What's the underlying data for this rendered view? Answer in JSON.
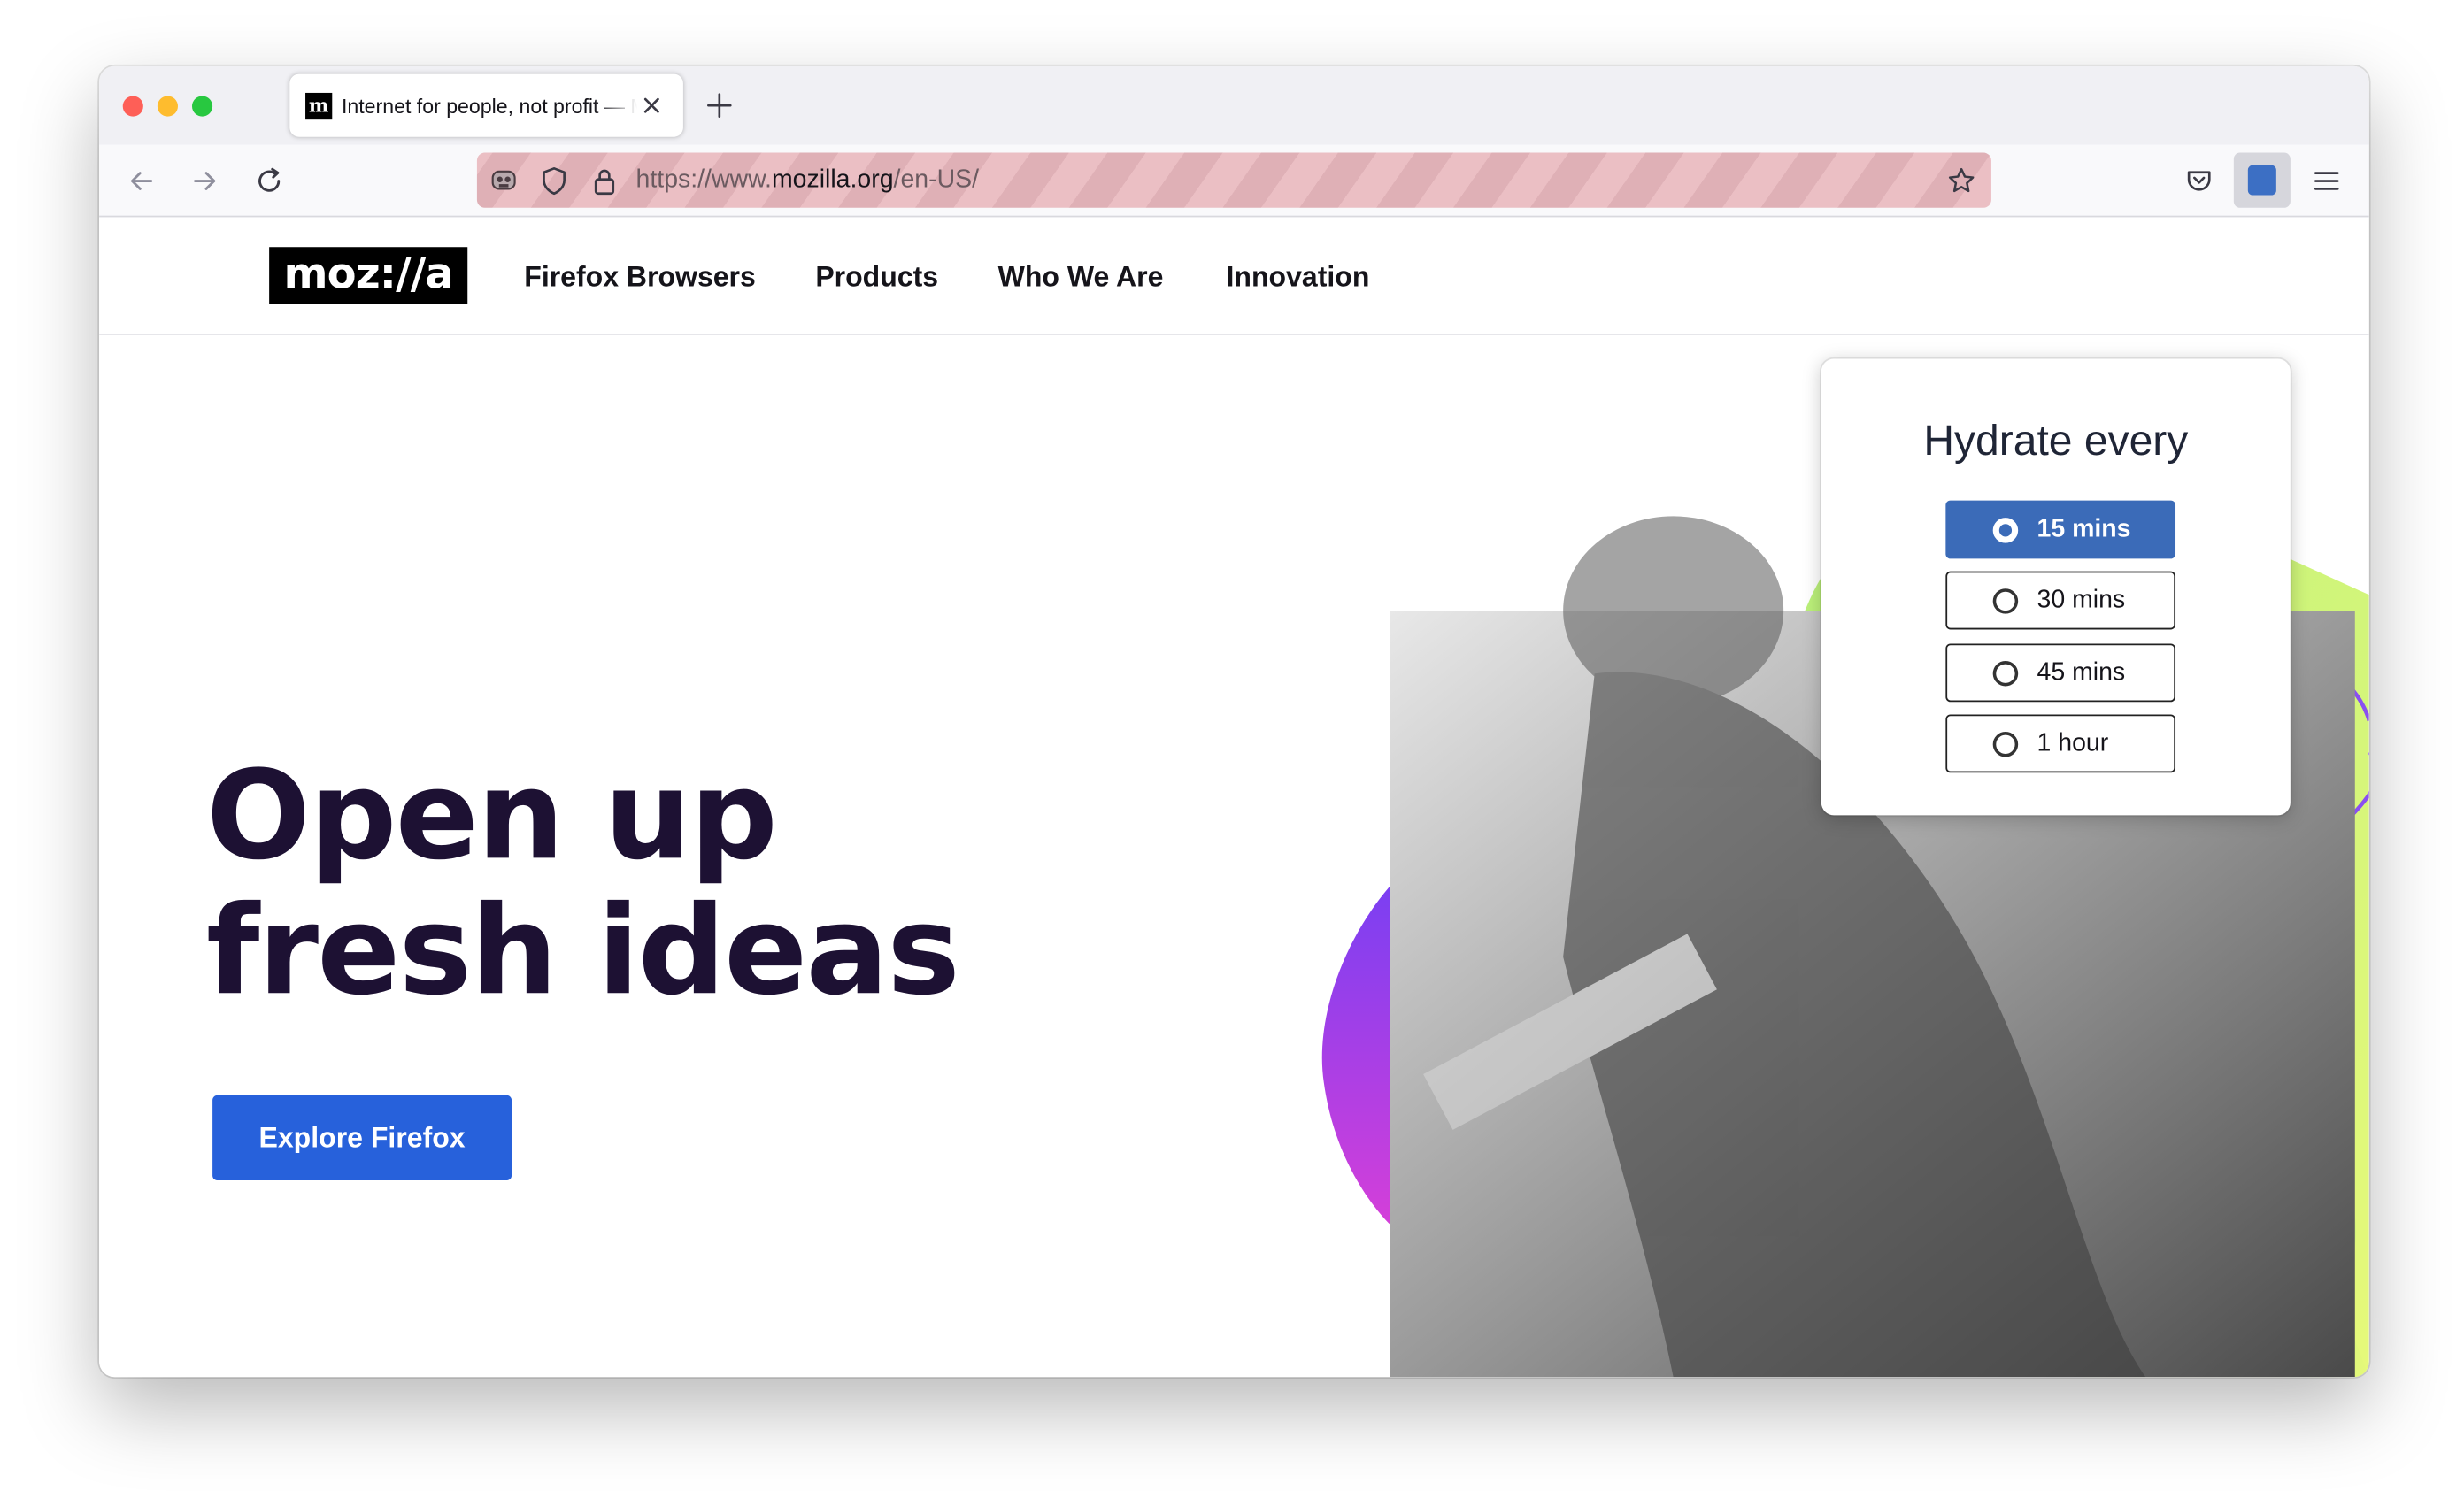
{
  "browser": {
    "tab": {
      "favicon_text": "m",
      "title": "Internet for people, not profit — Mozilla"
    },
    "url": {
      "scheme": "https://www.",
      "host": "mozilla.org",
      "path": "/en-US/"
    },
    "icons": {
      "back": "arrow-left-icon",
      "forward": "arrow-right-icon",
      "reload": "reload-icon",
      "shield": "shield-icon",
      "lock": "lock-icon",
      "bookmark": "star-icon",
      "pocket": "pocket-icon",
      "extension": "extension-icon",
      "menu": "hamburger-menu-icon"
    }
  },
  "site": {
    "logo": "moz://a",
    "nav": [
      "Firefox Browsers",
      "Products",
      "Who We Are",
      "Innovation"
    ],
    "hero": {
      "line1": "Open up",
      "line2": "fresh ideas",
      "cta": "Explore Firefox"
    }
  },
  "popup": {
    "title": "Hydrate every",
    "options": [
      "15 mins",
      "30 mins",
      "45 mins",
      "1 hour"
    ],
    "selected": "15 mins"
  },
  "colors": {
    "cta": "#2761db",
    "popup_selected": "#3b6bb8",
    "hero_text": "#1d1133"
  }
}
